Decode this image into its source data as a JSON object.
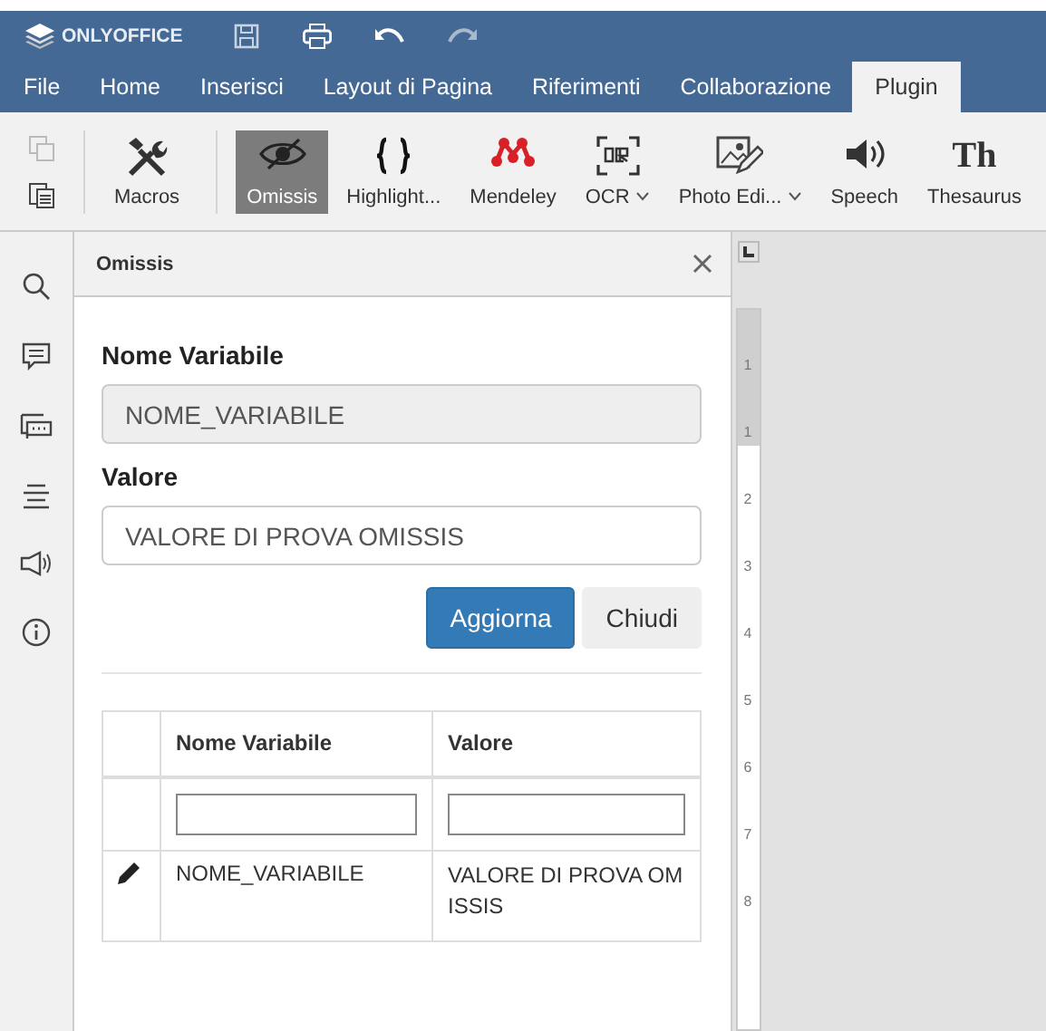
{
  "app": {
    "logo": "ONLYOFFICE"
  },
  "menu_tabs": [
    {
      "label": "File",
      "selected": false
    },
    {
      "label": "Home",
      "selected": false
    },
    {
      "label": "Inserisci",
      "selected": false
    },
    {
      "label": "Layout di Pagina",
      "selected": false
    },
    {
      "label": "Riferimenti",
      "selected": false
    },
    {
      "label": "Collaborazione",
      "selected": false
    },
    {
      "label": "Plugin",
      "selected": true
    }
  ],
  "toolbar": [
    {
      "kind": "macros",
      "label": "Macros",
      "selected": false,
      "dropdown": false
    },
    {
      "kind": "omissis",
      "label": "Omissis",
      "selected": true,
      "dropdown": false
    },
    {
      "kind": "highlight",
      "label": "Highlight...",
      "selected": false,
      "dropdown": false
    },
    {
      "kind": "mendeley",
      "label": "Mendeley",
      "selected": false,
      "dropdown": false
    },
    {
      "kind": "ocr",
      "label": "OCR",
      "selected": false,
      "dropdown": true
    },
    {
      "kind": "photo",
      "label": "Photo Edi...",
      "selected": false,
      "dropdown": true
    },
    {
      "kind": "speech",
      "label": "Speech",
      "selected": false,
      "dropdown": false
    },
    {
      "kind": "thesaurus",
      "label": "Thesaurus",
      "selected": false,
      "dropdown": false,
      "icon_text": "Th"
    }
  ],
  "panel": {
    "title": "Omissis",
    "fields": [
      {
        "label": "Nome Variabile",
        "value": "NOME_VARIABILE",
        "disabled": true
      },
      {
        "label": "Valore",
        "value": "VALORE DI PROVA OMISSIS",
        "disabled": false
      }
    ],
    "buttons": [
      {
        "label": "Aggiorna",
        "kind": "primary"
      },
      {
        "label": "Chiudi",
        "kind": "secondary"
      }
    ],
    "table": {
      "columns": [
        "Nome Variabile",
        "Valore"
      ],
      "rows": [
        {
          "name": "NOME_VARIABILE",
          "value": "VALORE DI PROVA OMISSIS"
        }
      ]
    }
  },
  "ruler": {
    "numbers": [
      "1",
      "1",
      "2",
      "3",
      "4",
      "5",
      "6",
      "7",
      "8"
    ]
  }
}
